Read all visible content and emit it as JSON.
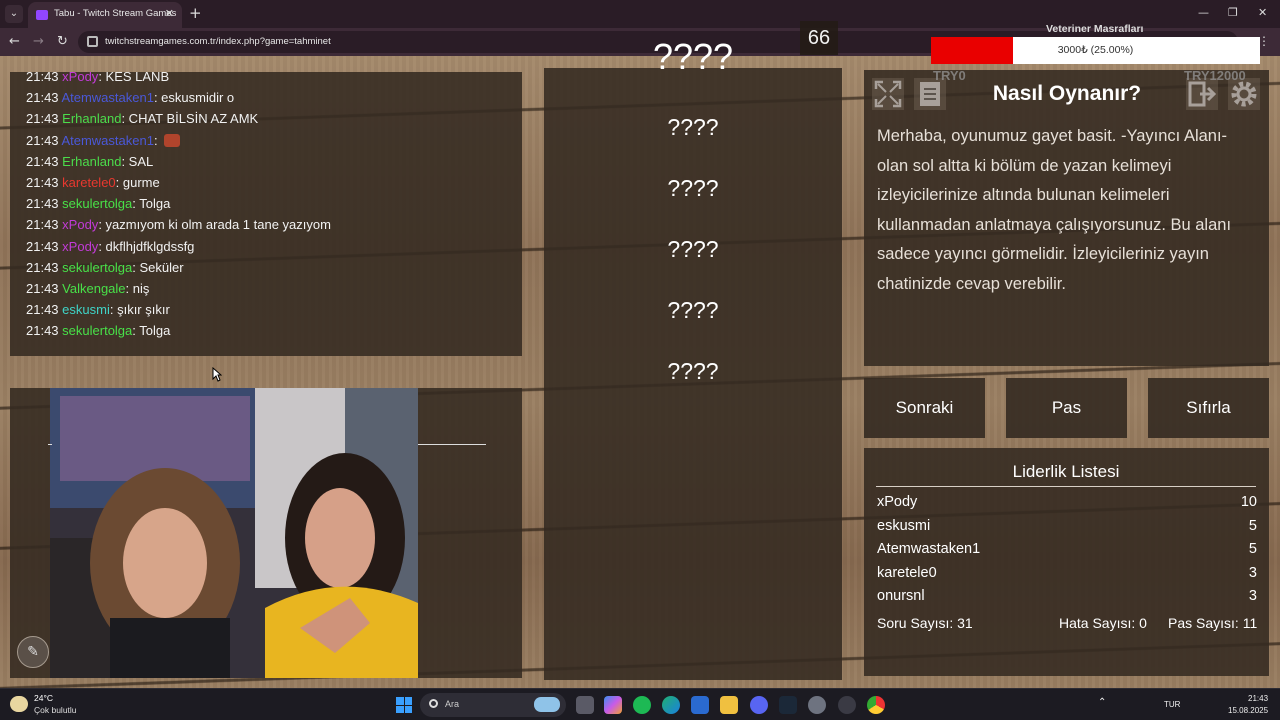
{
  "browser": {
    "tab_title": "Tabu - Twitch Stream Games",
    "url": "twitchstreamgames.com.tr/index.php?game=tahminet"
  },
  "chat": {
    "messages": [
      {
        "time": "21:43",
        "user": "xPody",
        "text": ": KES LANB",
        "color": "#c23bd8"
      },
      {
        "time": "21:43",
        "user": "Atemwastaken1",
        "text": ": eskusmidir o",
        "color": "#4a58d8"
      },
      {
        "time": "21:43",
        "user": "Erhanland",
        "text": ": CHAT BİLSİN AZ AMK",
        "color": "#4bdc4b"
      },
      {
        "time": "21:43",
        "user": "Atemwastaken1",
        "text": ":",
        "color": "#4a58d8",
        "emote": true
      },
      {
        "time": "21:43",
        "user": "Erhanland",
        "text": ": SAL",
        "color": "#4bdc4b"
      },
      {
        "time": "21:43",
        "user": "karetele0",
        "text": ": gurme",
        "color": "#e8382f"
      },
      {
        "time": "21:43",
        "user": "sekulertolga",
        "text": ": Tolga",
        "color": "#48e048"
      },
      {
        "time": "21:43",
        "user": "xPody",
        "text": ": yazmıyom ki olm arada 1 tane yazıyom",
        "color": "#c23bd8"
      },
      {
        "time": "21:43",
        "user": "xPody",
        "text": ": dkflhjdfklgdssfg",
        "color": "#c23bd8"
      },
      {
        "time": "21:43",
        "user": "sekulertolga",
        "text": ": Seküler",
        "color": "#48e048"
      },
      {
        "time": "21:43",
        "user": "Valkengale",
        "text": ": niş",
        "color": "#48e048"
      },
      {
        "time": "21:43",
        "user": "eskusmi",
        "text": ": şıkır şıkır",
        "color": "#3fd4c7"
      },
      {
        "time": "21:43",
        "user": "sekulertolga",
        "text": ": Tolga",
        "color": "#48e048"
      }
    ]
  },
  "game": {
    "counter": "66",
    "main_word": "????",
    "forbidden_words": [
      "????",
      "????",
      "????",
      "????",
      "????"
    ],
    "help_title": "Nasıl Oynanır?",
    "help_text": "Merhaba, oyunumuz gayet basit. -Yayıncı Alanı- olan sol altta ki bölüm de yazan kelimeyi izleyicilerinize altında bulunan kelimeleri kullanmadan anlatmaya çalışıyorsunuz. Bu alanı sadece yayıncı görmelidir. İzleyicileriniz yayın chatinizde cevap verebilir.",
    "buttons": {
      "next": "Sonraki",
      "pass": "Pas",
      "reset": "Sıfırla"
    }
  },
  "leaderboard": {
    "title": "Liderlik Listesi",
    "rows": [
      {
        "name": "xPody",
        "score": "10"
      },
      {
        "name": "eskusmi",
        "score": "5"
      },
      {
        "name": "Atemwastaken1",
        "score": "5"
      },
      {
        "name": "karetele0",
        "score": "3"
      },
      {
        "name": "onursnl",
        "score": "3"
      }
    ],
    "stats": {
      "questions": "Soru Sayısı: 31",
      "errors": "Hata Sayısı: 0",
      "passes": "Pas Sayısı: 11"
    }
  },
  "donation_goal": {
    "title": "Veteriner Masrafları",
    "progress_text": "3000₺ (25.00%)",
    "progress_fraction": 0.25,
    "min_label": "TRY0",
    "max_label": "TRY12000",
    "fill_color": "#e90000"
  },
  "taskbar": {
    "temperature": "24°C",
    "weather": "Çok bulutlu",
    "search_placeholder": "Ara",
    "language": "TUR",
    "time": "21:43",
    "date": "15.08.2025"
  }
}
